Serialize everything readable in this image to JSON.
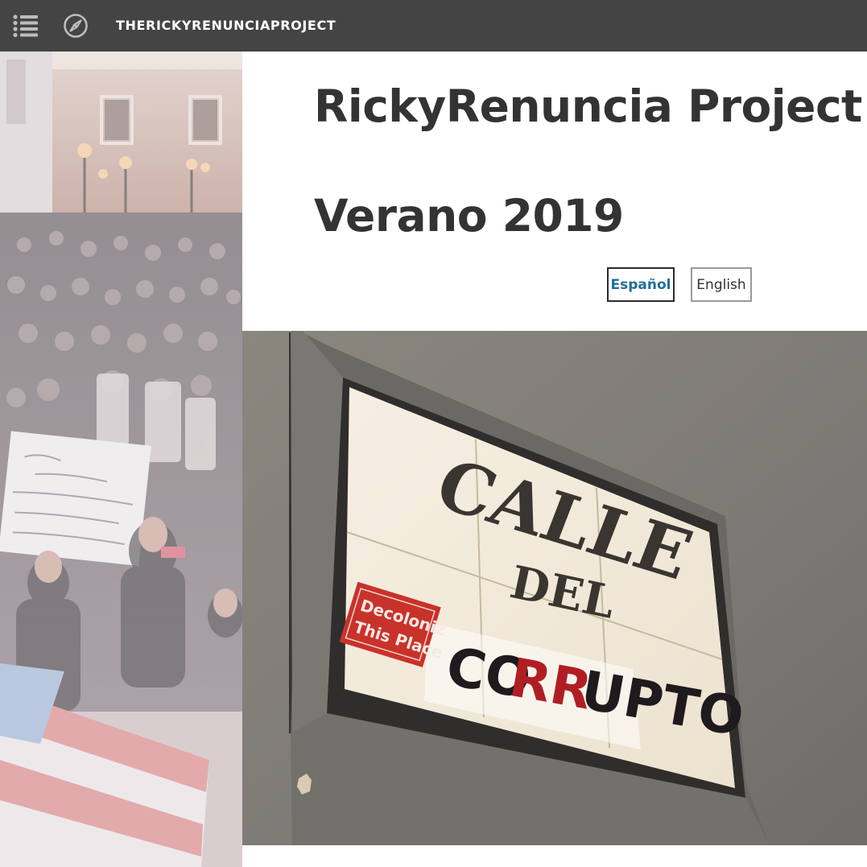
{
  "topbar": {
    "menu_icon": "list-menu-icon",
    "compass_icon": "compass-icon",
    "site_title": "THERICKYRENUNCIAPROJECT"
  },
  "heading": {
    "line1": "RickyRenuncia Project",
    "line2": "Verano 2019"
  },
  "language": {
    "spanish_label": "Español",
    "english_label": "English",
    "selected": "Español"
  },
  "main_photo": {
    "sign": {
      "line1": "CALLE",
      "line2": "DEL",
      "line3_part1": "CO",
      "line3_part2": "RR",
      "line3_part3": "UPTO",
      "sticker_line1": "Decoloniz",
      "sticker_line2": "This Place"
    }
  },
  "colors": {
    "topbar_bg": "#444444",
    "heading_text": "#333333",
    "spanish_link": "#1f6e9a",
    "sticker_red": "#c8322a",
    "sign_red_letters": "#b01e24"
  }
}
